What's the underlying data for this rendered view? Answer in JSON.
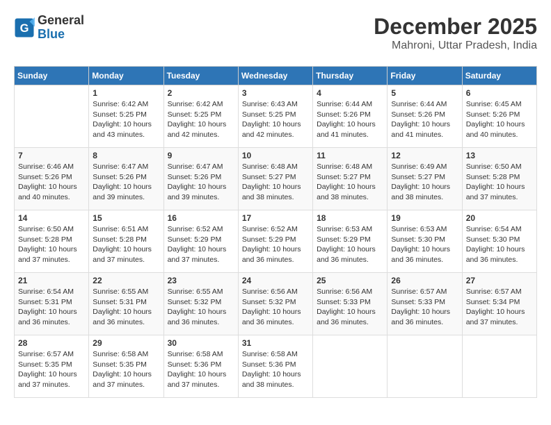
{
  "header": {
    "logo_line1": "General",
    "logo_line2": "Blue",
    "month_title": "December 2025",
    "location": "Mahroni, Uttar Pradesh, India"
  },
  "weekdays": [
    "Sunday",
    "Monday",
    "Tuesday",
    "Wednesday",
    "Thursday",
    "Friday",
    "Saturday"
  ],
  "weeks": [
    [
      {
        "day": "",
        "sunrise": "",
        "sunset": "",
        "daylight": ""
      },
      {
        "day": "1",
        "sunrise": "Sunrise: 6:42 AM",
        "sunset": "Sunset: 5:25 PM",
        "daylight": "Daylight: 10 hours and 43 minutes."
      },
      {
        "day": "2",
        "sunrise": "Sunrise: 6:42 AM",
        "sunset": "Sunset: 5:25 PM",
        "daylight": "Daylight: 10 hours and 42 minutes."
      },
      {
        "day": "3",
        "sunrise": "Sunrise: 6:43 AM",
        "sunset": "Sunset: 5:25 PM",
        "daylight": "Daylight: 10 hours and 42 minutes."
      },
      {
        "day": "4",
        "sunrise": "Sunrise: 6:44 AM",
        "sunset": "Sunset: 5:26 PM",
        "daylight": "Daylight: 10 hours and 41 minutes."
      },
      {
        "day": "5",
        "sunrise": "Sunrise: 6:44 AM",
        "sunset": "Sunset: 5:26 PM",
        "daylight": "Daylight: 10 hours and 41 minutes."
      },
      {
        "day": "6",
        "sunrise": "Sunrise: 6:45 AM",
        "sunset": "Sunset: 5:26 PM",
        "daylight": "Daylight: 10 hours and 40 minutes."
      }
    ],
    [
      {
        "day": "7",
        "sunrise": "Sunrise: 6:46 AM",
        "sunset": "Sunset: 5:26 PM",
        "daylight": "Daylight: 10 hours and 40 minutes."
      },
      {
        "day": "8",
        "sunrise": "Sunrise: 6:47 AM",
        "sunset": "Sunset: 5:26 PM",
        "daylight": "Daylight: 10 hours and 39 minutes."
      },
      {
        "day": "9",
        "sunrise": "Sunrise: 6:47 AM",
        "sunset": "Sunset: 5:26 PM",
        "daylight": "Daylight: 10 hours and 39 minutes."
      },
      {
        "day": "10",
        "sunrise": "Sunrise: 6:48 AM",
        "sunset": "Sunset: 5:27 PM",
        "daylight": "Daylight: 10 hours and 38 minutes."
      },
      {
        "day": "11",
        "sunrise": "Sunrise: 6:48 AM",
        "sunset": "Sunset: 5:27 PM",
        "daylight": "Daylight: 10 hours and 38 minutes."
      },
      {
        "day": "12",
        "sunrise": "Sunrise: 6:49 AM",
        "sunset": "Sunset: 5:27 PM",
        "daylight": "Daylight: 10 hours and 38 minutes."
      },
      {
        "day": "13",
        "sunrise": "Sunrise: 6:50 AM",
        "sunset": "Sunset: 5:28 PM",
        "daylight": "Daylight: 10 hours and 37 minutes."
      }
    ],
    [
      {
        "day": "14",
        "sunrise": "Sunrise: 6:50 AM",
        "sunset": "Sunset: 5:28 PM",
        "daylight": "Daylight: 10 hours and 37 minutes."
      },
      {
        "day": "15",
        "sunrise": "Sunrise: 6:51 AM",
        "sunset": "Sunset: 5:28 PM",
        "daylight": "Daylight: 10 hours and 37 minutes."
      },
      {
        "day": "16",
        "sunrise": "Sunrise: 6:52 AM",
        "sunset": "Sunset: 5:29 PM",
        "daylight": "Daylight: 10 hours and 37 minutes."
      },
      {
        "day": "17",
        "sunrise": "Sunrise: 6:52 AM",
        "sunset": "Sunset: 5:29 PM",
        "daylight": "Daylight: 10 hours and 36 minutes."
      },
      {
        "day": "18",
        "sunrise": "Sunrise: 6:53 AM",
        "sunset": "Sunset: 5:29 PM",
        "daylight": "Daylight: 10 hours and 36 minutes."
      },
      {
        "day": "19",
        "sunrise": "Sunrise: 6:53 AM",
        "sunset": "Sunset: 5:30 PM",
        "daylight": "Daylight: 10 hours and 36 minutes."
      },
      {
        "day": "20",
        "sunrise": "Sunrise: 6:54 AM",
        "sunset": "Sunset: 5:30 PM",
        "daylight": "Daylight: 10 hours and 36 minutes."
      }
    ],
    [
      {
        "day": "21",
        "sunrise": "Sunrise: 6:54 AM",
        "sunset": "Sunset: 5:31 PM",
        "daylight": "Daylight: 10 hours and 36 minutes."
      },
      {
        "day": "22",
        "sunrise": "Sunrise: 6:55 AM",
        "sunset": "Sunset: 5:31 PM",
        "daylight": "Daylight: 10 hours and 36 minutes."
      },
      {
        "day": "23",
        "sunrise": "Sunrise: 6:55 AM",
        "sunset": "Sunset: 5:32 PM",
        "daylight": "Daylight: 10 hours and 36 minutes."
      },
      {
        "day": "24",
        "sunrise": "Sunrise: 6:56 AM",
        "sunset": "Sunset: 5:32 PM",
        "daylight": "Daylight: 10 hours and 36 minutes."
      },
      {
        "day": "25",
        "sunrise": "Sunrise: 6:56 AM",
        "sunset": "Sunset: 5:33 PM",
        "daylight": "Daylight: 10 hours and 36 minutes."
      },
      {
        "day": "26",
        "sunrise": "Sunrise: 6:57 AM",
        "sunset": "Sunset: 5:33 PM",
        "daylight": "Daylight: 10 hours and 36 minutes."
      },
      {
        "day": "27",
        "sunrise": "Sunrise: 6:57 AM",
        "sunset": "Sunset: 5:34 PM",
        "daylight": "Daylight: 10 hours and 37 minutes."
      }
    ],
    [
      {
        "day": "28",
        "sunrise": "Sunrise: 6:57 AM",
        "sunset": "Sunset: 5:35 PM",
        "daylight": "Daylight: 10 hours and 37 minutes."
      },
      {
        "day": "29",
        "sunrise": "Sunrise: 6:58 AM",
        "sunset": "Sunset: 5:35 PM",
        "daylight": "Daylight: 10 hours and 37 minutes."
      },
      {
        "day": "30",
        "sunrise": "Sunrise: 6:58 AM",
        "sunset": "Sunset: 5:36 PM",
        "daylight": "Daylight: 10 hours and 37 minutes."
      },
      {
        "day": "31",
        "sunrise": "Sunrise: 6:58 AM",
        "sunset": "Sunset: 5:36 PM",
        "daylight": "Daylight: 10 hours and 38 minutes."
      },
      {
        "day": "",
        "sunrise": "",
        "sunset": "",
        "daylight": ""
      },
      {
        "day": "",
        "sunrise": "",
        "sunset": "",
        "daylight": ""
      },
      {
        "day": "",
        "sunrise": "",
        "sunset": "",
        "daylight": ""
      }
    ]
  ]
}
